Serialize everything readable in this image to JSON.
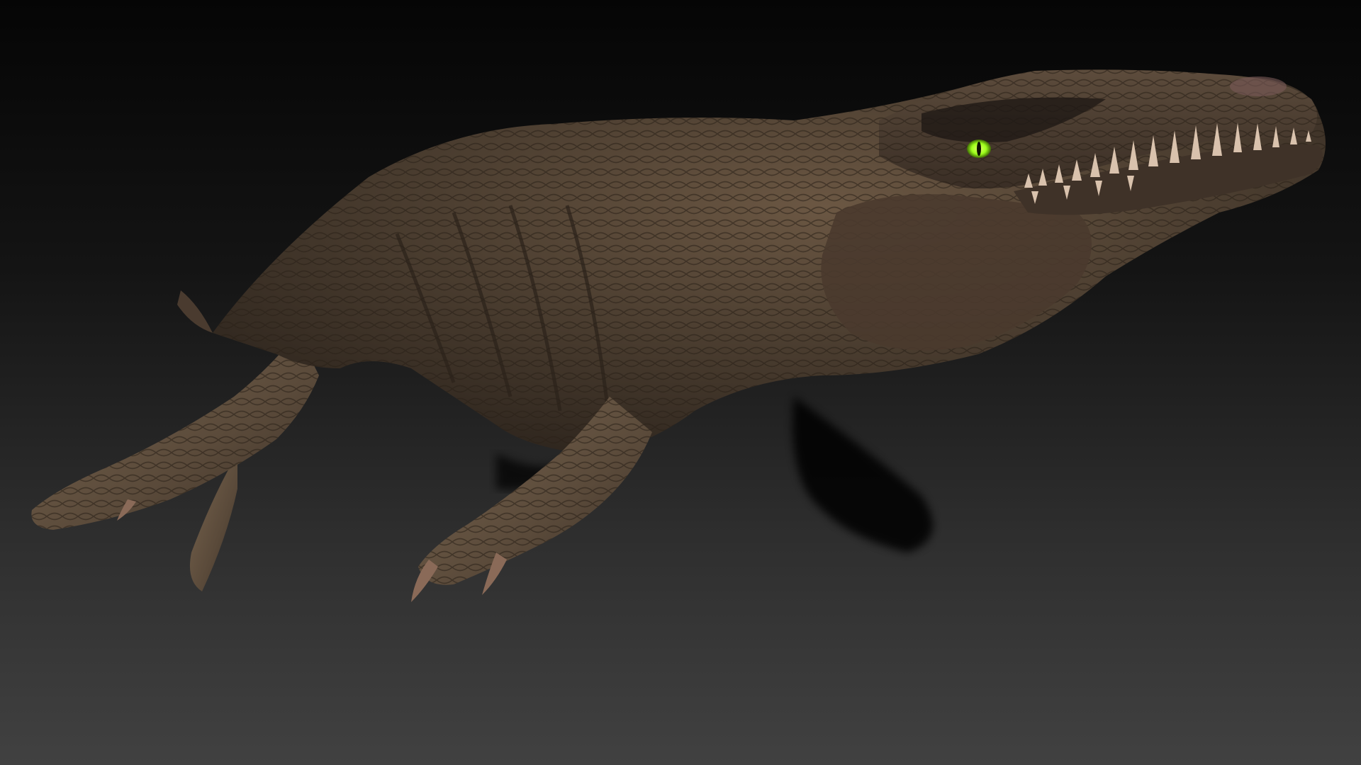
{
  "scene": {
    "subject": "sculpted-creature",
    "colors": {
      "background_top": "#050505",
      "background_bottom": "#414141",
      "skin_dark": "#3a2f25",
      "skin_mid": "#5b4a38",
      "skin_light": "#8a7358",
      "eye": "#9cff1a",
      "teeth": "#d9c2ad",
      "claws": "#8a6a58"
    }
  }
}
